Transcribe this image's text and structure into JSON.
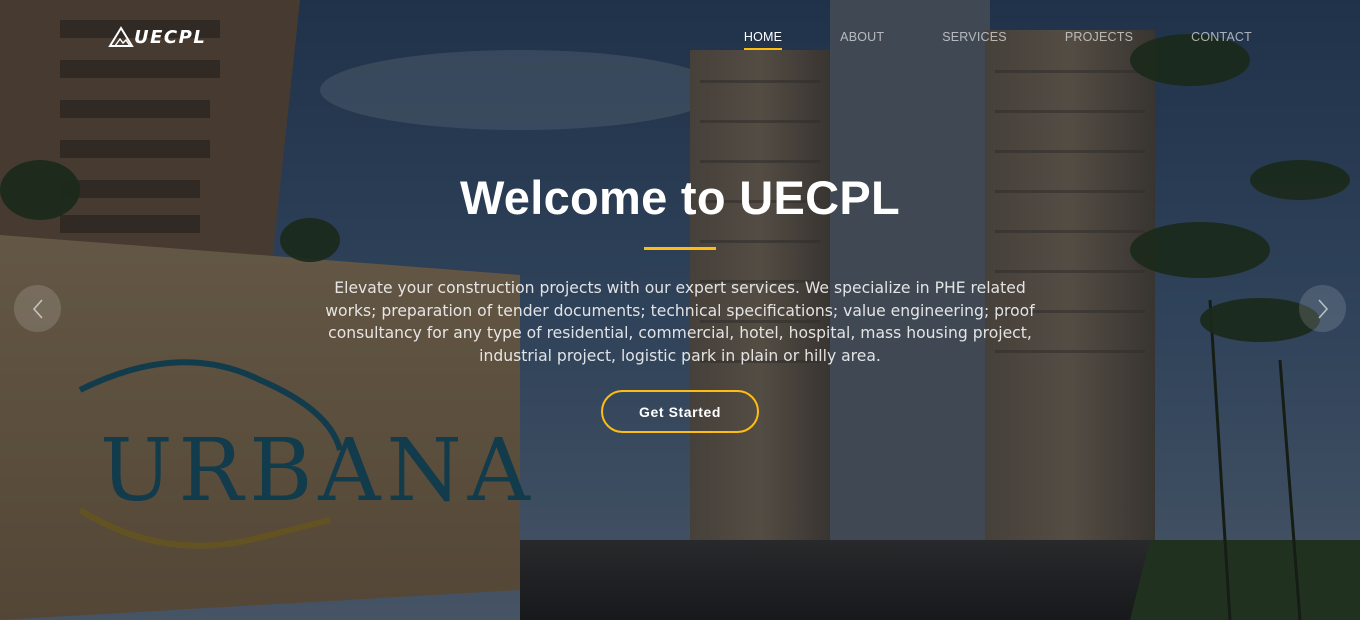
{
  "brand": {
    "name": "UECPL",
    "logo_icon": "triangle-mountain-icon"
  },
  "nav": {
    "items": [
      {
        "label": "HOME",
        "active": true
      },
      {
        "label": "ABOUT",
        "active": false
      },
      {
        "label": "SERVICES",
        "active": false
      },
      {
        "label": "PROJECTS",
        "active": false
      },
      {
        "label": "CONTACT",
        "active": false
      }
    ]
  },
  "hero": {
    "title": "Welcome to UECPL",
    "description": "Elevate your construction projects with our expert services. We specialize in PHE related works; preparation of tender documents; technical specifications; value engineering; proof consultancy for any type of residential, commercial, hotel, hospital, mass housing project, industrial project, logistic park in plain or hilly area.",
    "cta_label": "Get Started",
    "background_sign_text": "URBANA",
    "prev_icon": "chevron-left-icon",
    "next_icon": "chevron-right-icon"
  },
  "colors": {
    "accent": "#ffbc13",
    "text": "#ffffff"
  }
}
